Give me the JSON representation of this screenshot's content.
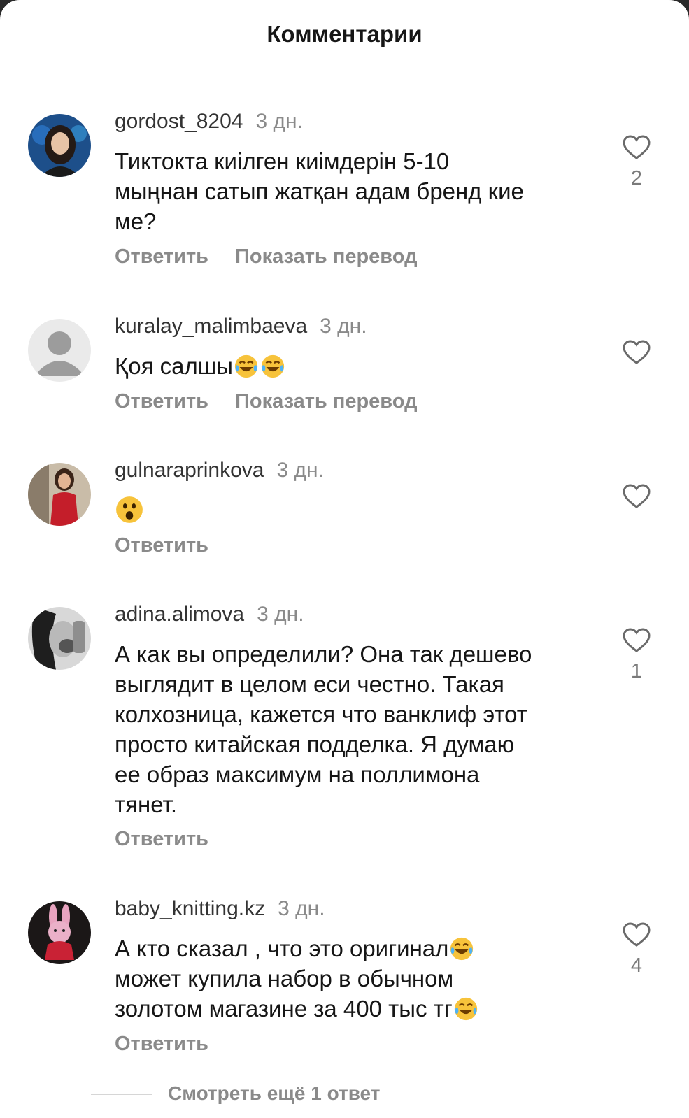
{
  "header": {
    "title": "Комментарии"
  },
  "comments": [
    {
      "username": "gordost_8204",
      "time": "3 дн.",
      "text_lines": [
        "Тиктокта киілген киімдерін 5-10",
        "мыңнан сатып жатқан адам бренд кие",
        "ме?"
      ],
      "reply_label": "Ответить",
      "translate_label": "Показать перевод",
      "likes": "2",
      "avatar": "photo-woman-dark-hair"
    },
    {
      "username": "kuralay_malimbaeva",
      "time": "3 дн.",
      "text": "Қоя салшы",
      "emojis": [
        "tears-of-joy-emoji",
        "tears-of-joy-emoji"
      ],
      "reply_label": "Ответить",
      "translate_label": "Показать перевод",
      "likes": "",
      "avatar": "default-user-avatar"
    },
    {
      "username": "gulnaraprinkova",
      "time": "3 дн.",
      "emojis": [
        "surprised-face-emoji"
      ],
      "reply_label": "Ответить",
      "likes": "",
      "avatar": "photo-woman-red-top"
    },
    {
      "username": "adina.alimova",
      "time": "3 дн.",
      "text_lines": [
        "А как вы определили? Она так дешево",
        "выглядит в целом еси честно. Такая",
        "колхозница, кажется что ванклиф этот",
        "просто китайская подделка. Я думаю",
        "ее образ максимум на поллимона",
        "тянет."
      ],
      "reply_label": "Ответить",
      "likes": "1",
      "avatar": "photo-black-white-selfie"
    },
    {
      "username": "baby_knitting.kz",
      "time": "3 дн.",
      "text_lines": [
        "А кто сказал , что это оригинал",
        "может купила набор в обычном",
        "золотом магазине за 400 тыс тг"
      ],
      "reply_label": "Ответить",
      "likes": "4",
      "avatar": "photo-knitted-pink-bunny"
    }
  ],
  "view_more": {
    "label": "Смотреть ещё 1 ответ"
  },
  "colors": {
    "text": "#161616",
    "muted": "#8a8a8a",
    "background": "#ffffff",
    "divider": "#ececec"
  }
}
